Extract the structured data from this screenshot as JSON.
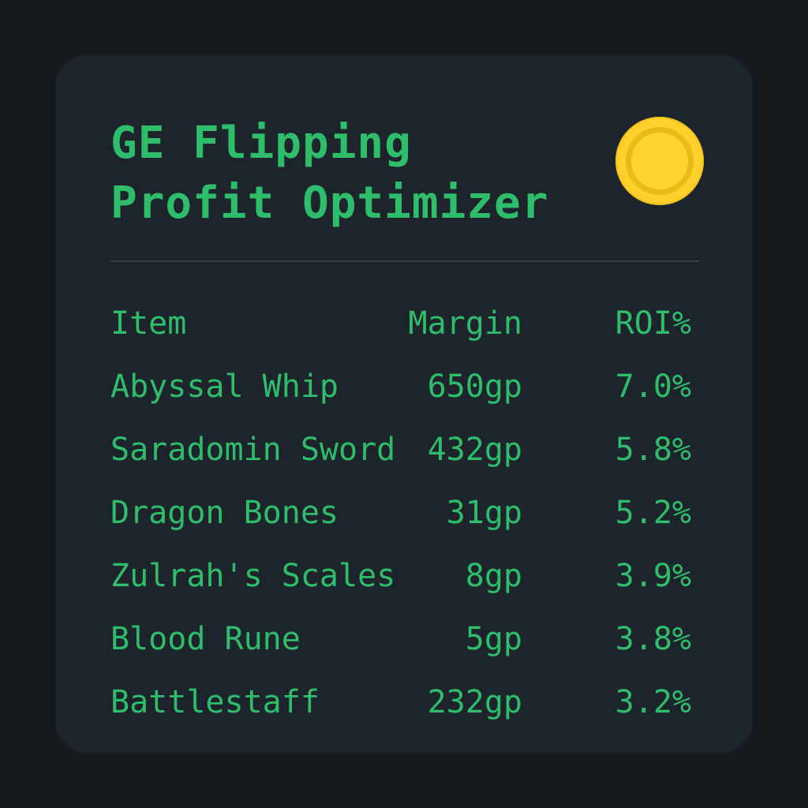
{
  "header": {
    "title_line1": "GE Flipping",
    "title_line2": "Profit Optimizer",
    "icon": "gold-coin-icon",
    "accent_color": "#2ebd6b",
    "coin_color": "#ffd12a"
  },
  "table": {
    "columns": [
      "Item",
      "Margin",
      "ROI%"
    ],
    "rows": [
      {
        "item": "Abyssal Whip",
        "margin": "650gp",
        "roi": "7.0%"
      },
      {
        "item": "Saradomin Sword",
        "margin": "432gp",
        "roi": "5.8%"
      },
      {
        "item": "Dragon Bones",
        "margin": "31gp",
        "roi": "5.2%"
      },
      {
        "item": "Zulrah's Scales",
        "margin": "8gp",
        "roi": "3.9%"
      },
      {
        "item": "Blood Rune",
        "margin": "5gp",
        "roi": "3.8%"
      },
      {
        "item": "Battlestaff",
        "margin": "232gp",
        "roi": "3.2%"
      }
    ]
  }
}
